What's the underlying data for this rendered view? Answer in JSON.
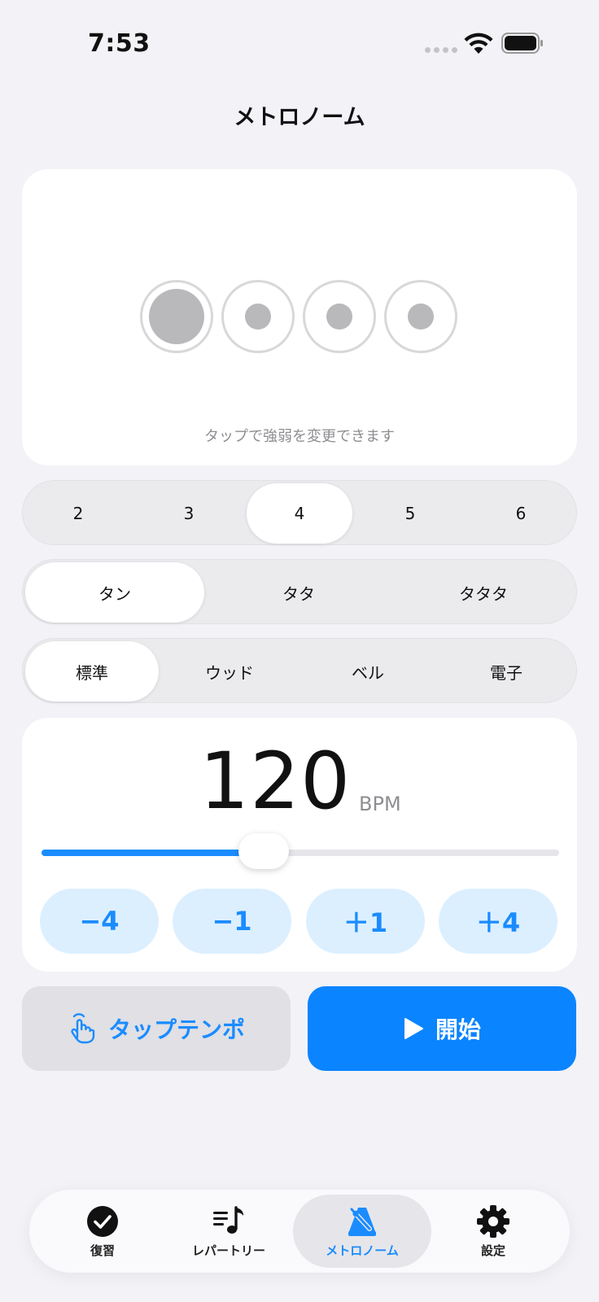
{
  "status_bar": {
    "time": "7:53"
  },
  "page": {
    "title": "メトロノーム"
  },
  "beats": {
    "hint": "タップで強弱を変更できます",
    "pattern": [
      "accent",
      "normal",
      "normal",
      "normal"
    ]
  },
  "time_signature": {
    "options": [
      "2",
      "3",
      "4",
      "5",
      "6"
    ],
    "selected": "4"
  },
  "subdivision": {
    "options": [
      "タン",
      "タタ",
      "タタタ"
    ],
    "selected": "タン"
  },
  "sound": {
    "options": [
      "標準",
      "ウッド",
      "ベル",
      "電子"
    ],
    "selected": "標準"
  },
  "tempo": {
    "bpm": "120",
    "unit": "BPM",
    "slider_fraction": 0.43,
    "steps": [
      "−4",
      "−1",
      "＋1",
      "＋4"
    ]
  },
  "actions": {
    "tap_tempo": "タップテンポ",
    "start": "開始"
  },
  "tabs": [
    {
      "label": "復習",
      "icon": "checkmark-circle-icon"
    },
    {
      "label": "レパートリー",
      "icon": "music-list-icon"
    },
    {
      "label": "メトロノーム",
      "icon": "metronome-icon",
      "active": true
    },
    {
      "label": "設定",
      "icon": "gear-icon"
    }
  ],
  "colors": {
    "accent": "#1a8cff",
    "primary_button": "#0a84ff",
    "background": "#f2f2f7"
  }
}
